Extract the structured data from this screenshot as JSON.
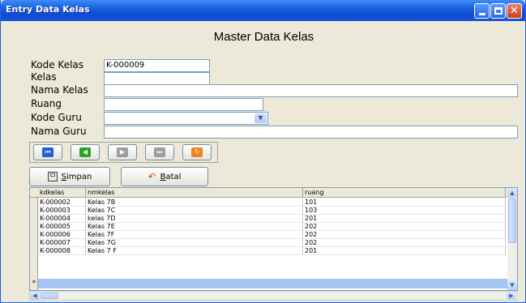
{
  "window": {
    "title": "Entry Data Kelas"
  },
  "form": {
    "heading": "Master Data Kelas",
    "kode_kelas": {
      "label": "Kode Kelas",
      "value": "K-000009"
    },
    "kelas": {
      "label": "Kelas",
      "value": ""
    },
    "nama_kelas": {
      "label": "Nama Kelas",
      "value": ""
    },
    "ruang": {
      "label": "Ruang",
      "value": ""
    },
    "kode_guru": {
      "label": "Kode Guru",
      "value": ""
    },
    "nama_guru": {
      "label": "Nama Guru",
      "value": ""
    }
  },
  "navigation": {
    "buttons": [
      {
        "name": "first-record-button",
        "icon": "first-icon",
        "color": "#1f5fd8",
        "glyph": "⏮"
      },
      {
        "name": "previous-record-button",
        "icon": "previous-icon",
        "color": "#28a428",
        "glyph": "◀"
      },
      {
        "name": "next-record-button",
        "icon": "next-icon",
        "color": "#9c9c9c",
        "glyph": "▶"
      },
      {
        "name": "last-record-button",
        "icon": "last-icon",
        "color": "#9c9c9c",
        "glyph": "⏭"
      },
      {
        "name": "refresh-button",
        "icon": "refresh-icon",
        "color": "#f08020",
        "glyph": "↻"
      }
    ]
  },
  "actions": {
    "save_label": "Simpan",
    "cancel_label": "Batal",
    "save_shortcut": "S",
    "cancel_shortcut": "B"
  },
  "grid": {
    "columns": [
      "kdkelas",
      "nmkelas",
      "ruang"
    ],
    "rows": [
      [
        "K-000002",
        "Kelas 7B",
        "101"
      ],
      [
        "K-000003",
        "Kelas 7C",
        "103"
      ],
      [
        "K-000004",
        "kelas 7D",
        "201"
      ],
      [
        "K-000005",
        "Kelas 7E",
        "202"
      ],
      [
        "K-000006",
        "Kelas 7F",
        "202"
      ],
      [
        "K-000007",
        "Kelas 7G",
        "202"
      ],
      [
        "K-000008",
        "Kelas 7 F",
        "201"
      ]
    ],
    "new_row_marker": "*"
  }
}
